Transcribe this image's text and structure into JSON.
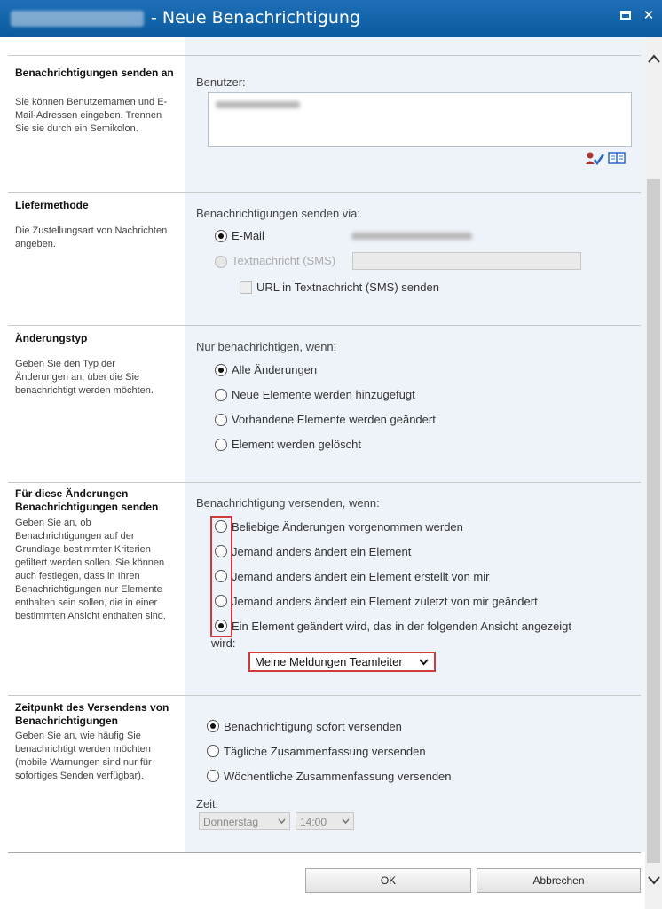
{
  "window": {
    "title": "- Neue Benachrichtigung",
    "maximize_glyph": "",
    "close_glyph": "✕"
  },
  "sections": {
    "recipients": {
      "title": "Benachrichtigungen senden an",
      "desc": "Sie können Benutzernamen und E-Mail-Adressen eingeben. Trennen Sie sie durch ein Semikolon.",
      "label": "Benutzer:"
    },
    "delivery": {
      "title": "Liefermethode",
      "desc": "Die Zustellungsart von Nachrichten angeben.",
      "label": "Benachrichtigungen senden via:",
      "email_label": "E-Mail",
      "sms_label": "Textnachricht (SMS)",
      "url_sms_label": "URL in Textnachricht (SMS) senden"
    },
    "change_type": {
      "title": "Änderungstyp",
      "desc": "Geben Sie den Typ der Änderungen an, über die Sie benachrichtigt werden möchten.",
      "label": "Nur benachrichtigen, wenn:",
      "options": [
        "Alle Änderungen",
        "Neue Elemente werden hinzugefügt",
        "Vorhandene Elemente werden geändert",
        "Element werden gelöscht"
      ],
      "selected": 0
    },
    "filter": {
      "title": "Für diese Änderungen Benachrichtigungen senden",
      "desc": "Geben Sie an, ob Benachrichtigungen auf der Grundlage bestimmter Kriterien gefiltert werden sollen. Sie können auch festlegen, dass in Ihren Benachrichtigungen nur Elemente enthalten sein sollen, die in einer bestimmten Ansicht enthalten sind.",
      "label": "Benachrichtigung versenden, wenn:",
      "options": [
        "Beliebige Änderungen vorgenommen werden",
        "Jemand anders ändert ein Element",
        "Jemand anders ändert ein Element erstellt von mir",
        "Jemand anders ändert ein Element zuletzt von mir geändert",
        "Ein Element geändert wird, das in der folgenden Ansicht angezeigt"
      ],
      "option5_wrap": "wird:",
      "selected": 4,
      "view_select": "Meine Meldungen Teamleiter"
    },
    "timing": {
      "title": "Zeitpunkt des Versendens von Benachrichtigungen",
      "desc": "Geben Sie an, wie häufig Sie benachrichtigt werden möchten (mobile Warnungen sind nur für sofortiges Senden verfügbar).",
      "options": [
        "Benachrichtigung sofort versenden",
        "Tägliche Zusammenfassung versenden",
        "Wöchentliche Zusammenfassung versenden"
      ],
      "selected": 0,
      "time_label": "Zeit:",
      "day_select": "Donnerstag",
      "time_select": "14:00"
    }
  },
  "buttons": {
    "ok": "OK",
    "cancel": "Abbrechen"
  }
}
